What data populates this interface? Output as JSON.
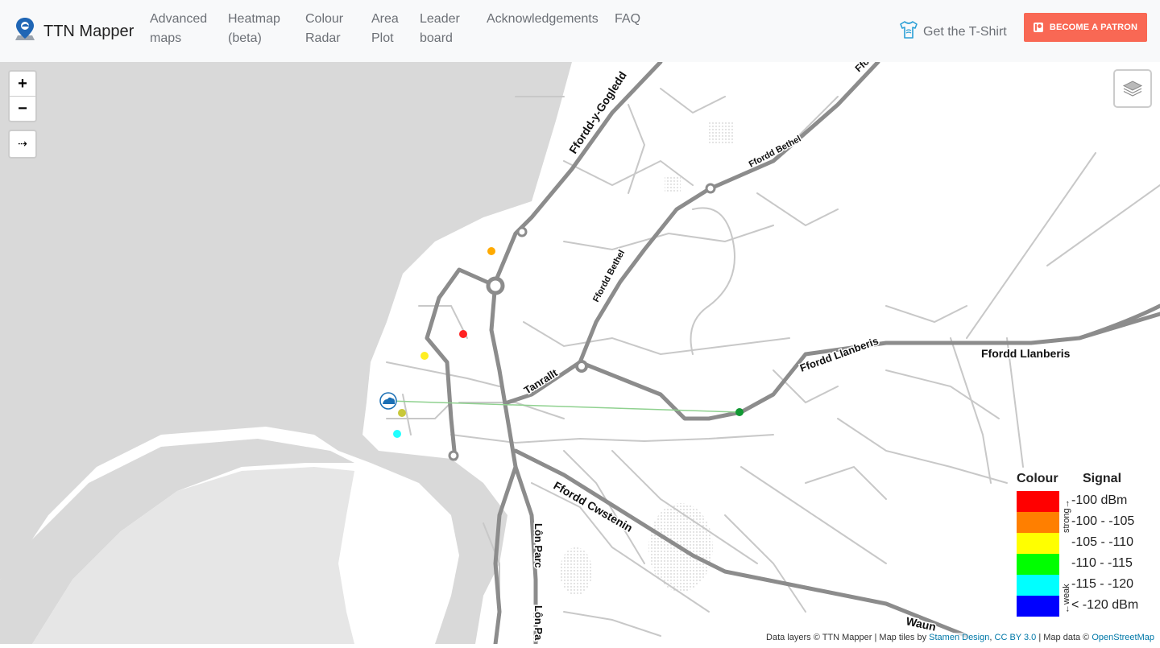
{
  "navbar": {
    "brand": "TTN Mapper",
    "items": [
      {
        "line1": "Advanced",
        "line2": "maps"
      },
      {
        "line1": "Heatmap",
        "line2": "(beta)"
      },
      {
        "line1": "Colour",
        "line2": "Radar"
      },
      {
        "line1": "Area",
        "line2": "Plot"
      },
      {
        "line1": "Leader",
        "line2": "board"
      },
      {
        "line1": "Acknowledgements",
        "line2": ""
      },
      {
        "line1": "FAQ",
        "line2": ""
      }
    ],
    "tshirt_label": "Get the T-Shirt",
    "patron_label": "BECOME A PATRON"
  },
  "map_controls": {
    "zoom_in": "+",
    "zoom_out": "−",
    "extra": "⇢"
  },
  "road_labels": [
    "Ffordd-y-Gogledd",
    "Ffordd Bethel",
    "Ffordd Bethel",
    "Ffordd Llanberis",
    "Ffordd Llanberis",
    "Tanrallt",
    "Ffordd Cwstenin",
    "Lôn Parc",
    "Lôn Pa",
    "Ffo",
    "Waun"
  ],
  "legend": {
    "colour_header": "Colour",
    "signal_header": "Signal",
    "strong_label": "strong→",
    "weak_label": "←weak",
    "entries": [
      {
        "color": "#ff0000",
        "label": "-100 dBm"
      },
      {
        "color": "#ff7f00",
        "label": "-100 - -105"
      },
      {
        "color": "#ffff00",
        "label": "-105 - -110"
      },
      {
        "color": "#00ff00",
        "label": "-110 - -115"
      },
      {
        "color": "#00ffff",
        "label": "-115 - -120"
      },
      {
        "color": "#0000ff",
        "label": "< -120 dBm"
      }
    ]
  },
  "markers": [
    {
      "name": "orange-point",
      "color": "#ffaa00"
    },
    {
      "name": "red-point",
      "color": "#ff2222"
    },
    {
      "name": "yellow-point",
      "color": "#ffee22"
    },
    {
      "name": "olive-point",
      "color": "#c8c83a"
    },
    {
      "name": "cyan-point",
      "color": "#22ffff"
    },
    {
      "name": "green-point",
      "color": "#119933"
    }
  ],
  "attribution": {
    "prefix": "Data layers © TTN Mapper | Map tiles by ",
    "stamen": "Stamen Design",
    "comma": ", ",
    "cc": "CC BY 3.0",
    "mid": " | Map data © ",
    "osm": "OpenStreetMap"
  },
  "colors": {
    "water": "#d9d9d9",
    "major_road": "#8c8c8c",
    "minor_road": "#c8c8c8",
    "gateway": "#1a6fb5",
    "link_line": "#8fd18f",
    "patron": "#f96854"
  }
}
